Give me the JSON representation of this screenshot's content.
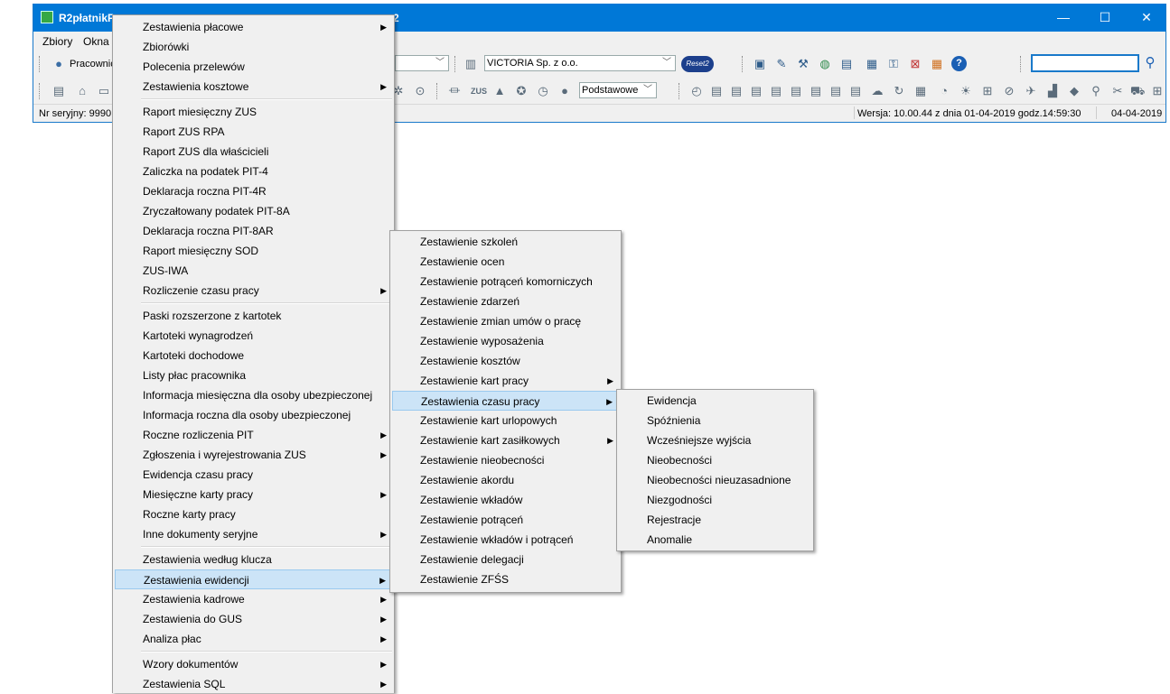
{
  "window": {
    "title": "R2płatnikP",
    "title_suffix": "2",
    "minimize": "—",
    "maximize": "☐",
    "close": "✕"
  },
  "menubar": {
    "items": [
      "Zbiory",
      "Okna"
    ]
  },
  "toolbar": {
    "pracownicy_label": "Pracownic",
    "company_combo": "VICTORIA Sp. z o.o.",
    "reset_badge": "Reset2",
    "mode_combo": "Podstawowe",
    "search_placeholder": ""
  },
  "statusbar": {
    "serial": "Nr seryjny: 9990",
    "version": "Wersja: 10.00.44 z dnia 01-04-2019 godz.14:59:30",
    "date": "04-04-2019"
  },
  "menu_main": {
    "items": [
      {
        "label": "Zestawienia płacowe",
        "sub": true
      },
      {
        "label": "Zbiorówki",
        "sub": false
      },
      {
        "label": "Polecenia przelewów",
        "sub": false
      },
      {
        "label": "Zestawienia kosztowe",
        "sub": true
      },
      {
        "label": "Raport miesięczny ZUS",
        "sub": false
      },
      {
        "label": "Raport ZUS RPA",
        "sub": false
      },
      {
        "label": "Raport ZUS dla właścicieli",
        "sub": false
      },
      {
        "label": "Zaliczka na podatek PIT-4",
        "sub": false
      },
      {
        "label": "Deklaracja roczna PIT-4R",
        "sub": false
      },
      {
        "label": "Zryczałtowany podatek PIT-8A",
        "sub": false
      },
      {
        "label": "Deklaracja roczna PIT-8AR",
        "sub": false
      },
      {
        "label": "Raport miesięczny SOD",
        "sub": false
      },
      {
        "label": "ZUS-IWA",
        "sub": false
      },
      {
        "label": "Rozliczenie czasu pracy",
        "sub": true
      },
      {
        "label": "Paski rozszerzone z kartotek",
        "sub": false
      },
      {
        "label": "Kartoteki wynagrodzeń",
        "sub": false
      },
      {
        "label": "Kartoteki dochodowe",
        "sub": false
      },
      {
        "label": "Listy płac pracownika",
        "sub": false
      },
      {
        "label": "Informacja miesięczna dla osoby ubezpieczonej",
        "sub": false
      },
      {
        "label": "Informacja roczna dla osoby ubezpieczonej",
        "sub": false
      },
      {
        "label": "Roczne rozliczenia PIT",
        "sub": true
      },
      {
        "label": "Zgłoszenia i wyrejestrowania ZUS",
        "sub": true
      },
      {
        "label": "Ewidencja czasu pracy",
        "sub": false
      },
      {
        "label": "Miesięczne karty pracy",
        "sub": true
      },
      {
        "label": "Roczne karty pracy",
        "sub": false
      },
      {
        "label": "Inne dokumenty seryjne",
        "sub": true
      },
      {
        "label": "Zestawienia według klucza",
        "sub": false
      },
      {
        "label": "Zestawienia ewidencji",
        "sub": true
      },
      {
        "label": "Zestawienia kadrowe",
        "sub": true
      },
      {
        "label": "Zestawienia do GUS",
        "sub": true
      },
      {
        "label": "Analiza płac",
        "sub": true
      },
      {
        "label": "Wzory dokumentów",
        "sub": true
      },
      {
        "label": "Zestawienia SQL",
        "sub": true
      }
    ]
  },
  "menu_ewidencji": {
    "items": [
      {
        "label": "Zestawienie szkoleń",
        "sub": false
      },
      {
        "label": "Zestawienie ocen",
        "sub": false
      },
      {
        "label": "Zestawienie potrąceń komorniczych",
        "sub": false
      },
      {
        "label": "Zestawienie zdarzeń",
        "sub": false
      },
      {
        "label": "Zestawienie zmian umów o pracę",
        "sub": false
      },
      {
        "label": "Zestawienie wyposażenia",
        "sub": false
      },
      {
        "label": "Zestawienie kosztów",
        "sub": false
      },
      {
        "label": "Zestawienie kart pracy",
        "sub": true
      },
      {
        "label": "Zestawienia czasu pracy",
        "sub": true
      },
      {
        "label": "Zestawienie kart urlopowych",
        "sub": false
      },
      {
        "label": "Zestawienie kart zasiłkowych",
        "sub": true
      },
      {
        "label": "Zestawienie nieobecności",
        "sub": false
      },
      {
        "label": "Zestawienie akordu",
        "sub": false
      },
      {
        "label": "Zestawienie wkładów",
        "sub": false
      },
      {
        "label": "Zestawienie potrąceń",
        "sub": false
      },
      {
        "label": "Zestawienie wkładów i potrąceń",
        "sub": false
      },
      {
        "label": "Zestawienie delegacji",
        "sub": false
      },
      {
        "label": "Zestawienie ZFŚS",
        "sub": false
      }
    ]
  },
  "menu_czasu": {
    "items": [
      {
        "label": "Ewidencja"
      },
      {
        "label": "Spóźnienia"
      },
      {
        "label": "Wcześniejsze wyjścia"
      },
      {
        "label": "Nieobecności"
      },
      {
        "label": "Nieobecności nieuzasadnione"
      },
      {
        "label": "Niezgodności"
      },
      {
        "label": "Rejestracje"
      },
      {
        "label": "Anomalie"
      }
    ]
  },
  "colors": {
    "titlebar": "#0078d7",
    "highlight": "#cce4f7",
    "menu_bg": "#f0f0f0"
  }
}
